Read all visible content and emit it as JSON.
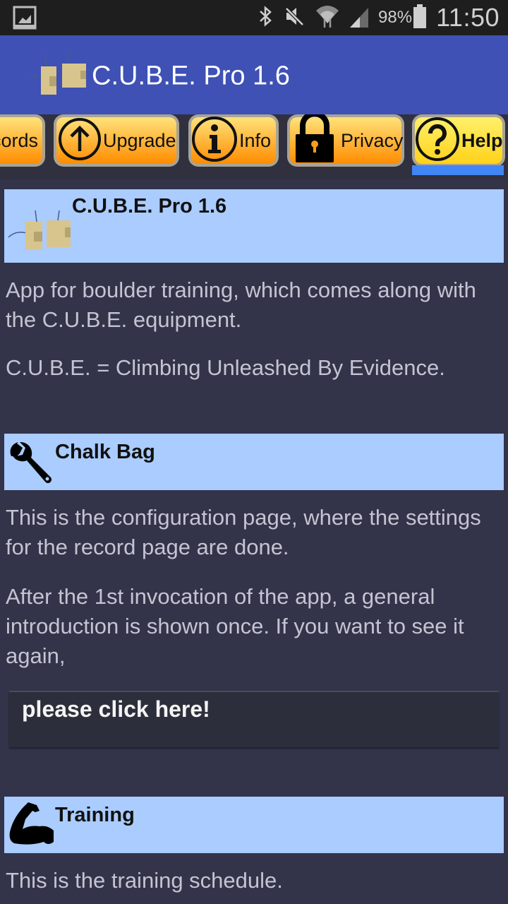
{
  "status_bar": {
    "left_icon": "image-notification-icon",
    "icons": [
      "bluetooth-icon",
      "mute-icon",
      "wifi-icon",
      "signal-icon",
      "battery-icon"
    ],
    "battery_percent": "98%",
    "time": "11:50"
  },
  "app_bar": {
    "logo_icon": "cube-logo-icon",
    "title": "C.U.B.E. Pro 1.6"
  },
  "tabs": [
    {
      "label": "Records",
      "visible_label": "cords",
      "icon": null,
      "active": false
    },
    {
      "label": "Upgrade",
      "icon": "arrow-up-circle-icon",
      "active": false
    },
    {
      "label": "Info",
      "icon": "info-circle-icon",
      "active": false
    },
    {
      "label": "Privacy",
      "icon": "lock-icon",
      "active": false
    },
    {
      "label": "Help",
      "icon": "question-circle-icon",
      "active": true
    }
  ],
  "accent_colors": {
    "app_bar": "#3f51b5",
    "tab_indicator": "#4285f4",
    "section_header": "#aaccff",
    "background": "#33334a"
  },
  "sections": [
    {
      "icon": "cube-logo-icon",
      "title": "C.U.B.E. Pro 1.6",
      "paragraphs": [
        "App for boulder training, which comes along with the C.U.B.E. equipment.",
        "C.U.B.E. = Climbing Unleashed By Evidence."
      ]
    },
    {
      "icon": "wrench-icon",
      "title": "Chalk Bag",
      "paragraphs": [
        "This is the configuration page, where the settings for the record page are done.",
        "After the 1st invocation of the app, a general introduction is shown once. If you want to see it again,"
      ],
      "button_label": "please click here!"
    },
    {
      "icon": "flexed-arm-icon",
      "title": "Training",
      "paragraphs": [
        "This is the training schedule."
      ]
    }
  ]
}
